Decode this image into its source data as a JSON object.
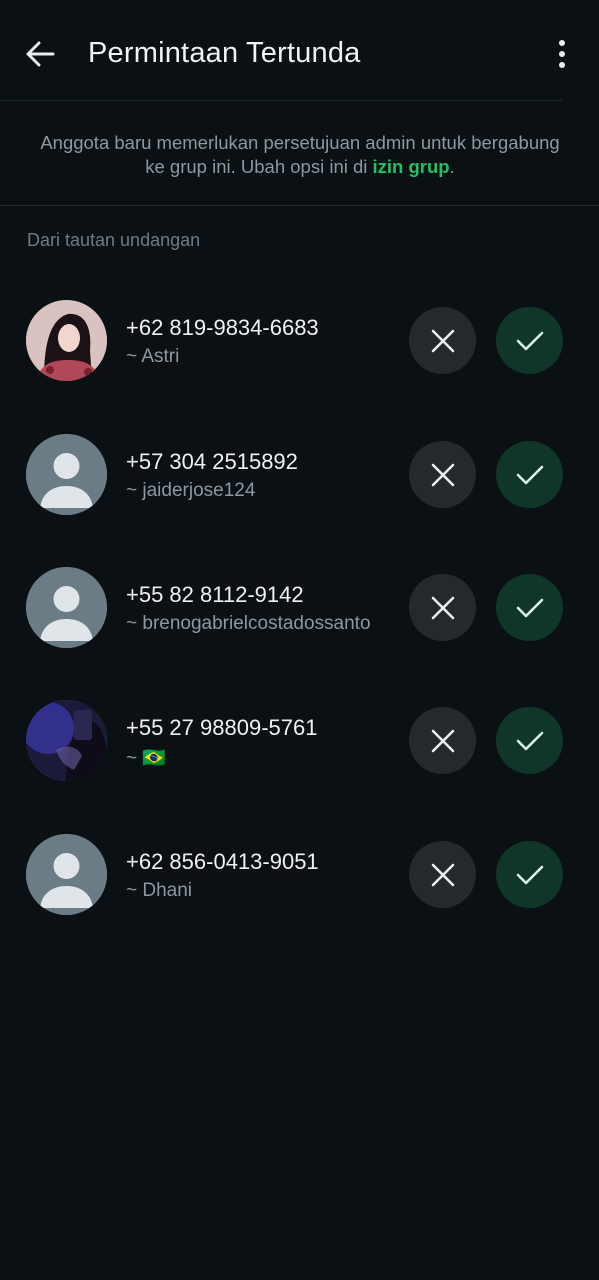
{
  "header": {
    "title": "Permintaan Tertunda",
    "back_icon": "arrow-left-icon",
    "menu_icon": "more-vertical-icon"
  },
  "info": {
    "text_before": "Anggota baru memerlukan persetujuan admin untuk bergabung ke grup ini. Ubah opsi ini di ",
    "link_text": "izin grup",
    "text_after": "."
  },
  "section_label": "Dari tautan undangan",
  "colors": {
    "background": "#0b1014",
    "accent": "#21c063",
    "approve_bg": "#103529",
    "reject_bg": "#23292d"
  },
  "requests": [
    {
      "phone": "+62 819-9834-6683",
      "alias": "~ Astri",
      "avatar": "photo-woman"
    },
    {
      "phone": "+57 304 2515892",
      "alias": "~ jaiderjose124",
      "avatar": "default-person"
    },
    {
      "phone": "+55 82 8112-9142",
      "alias": "~ brenogabrielcostadossanto",
      "avatar": "default-person"
    },
    {
      "phone": "+55 27 98809-5761",
      "alias": "~ 🇧🇷",
      "avatar": "photo-dark"
    },
    {
      "phone": "+62 856-0413-9051",
      "alias": "~ Dhani",
      "avatar": "default-person"
    }
  ]
}
